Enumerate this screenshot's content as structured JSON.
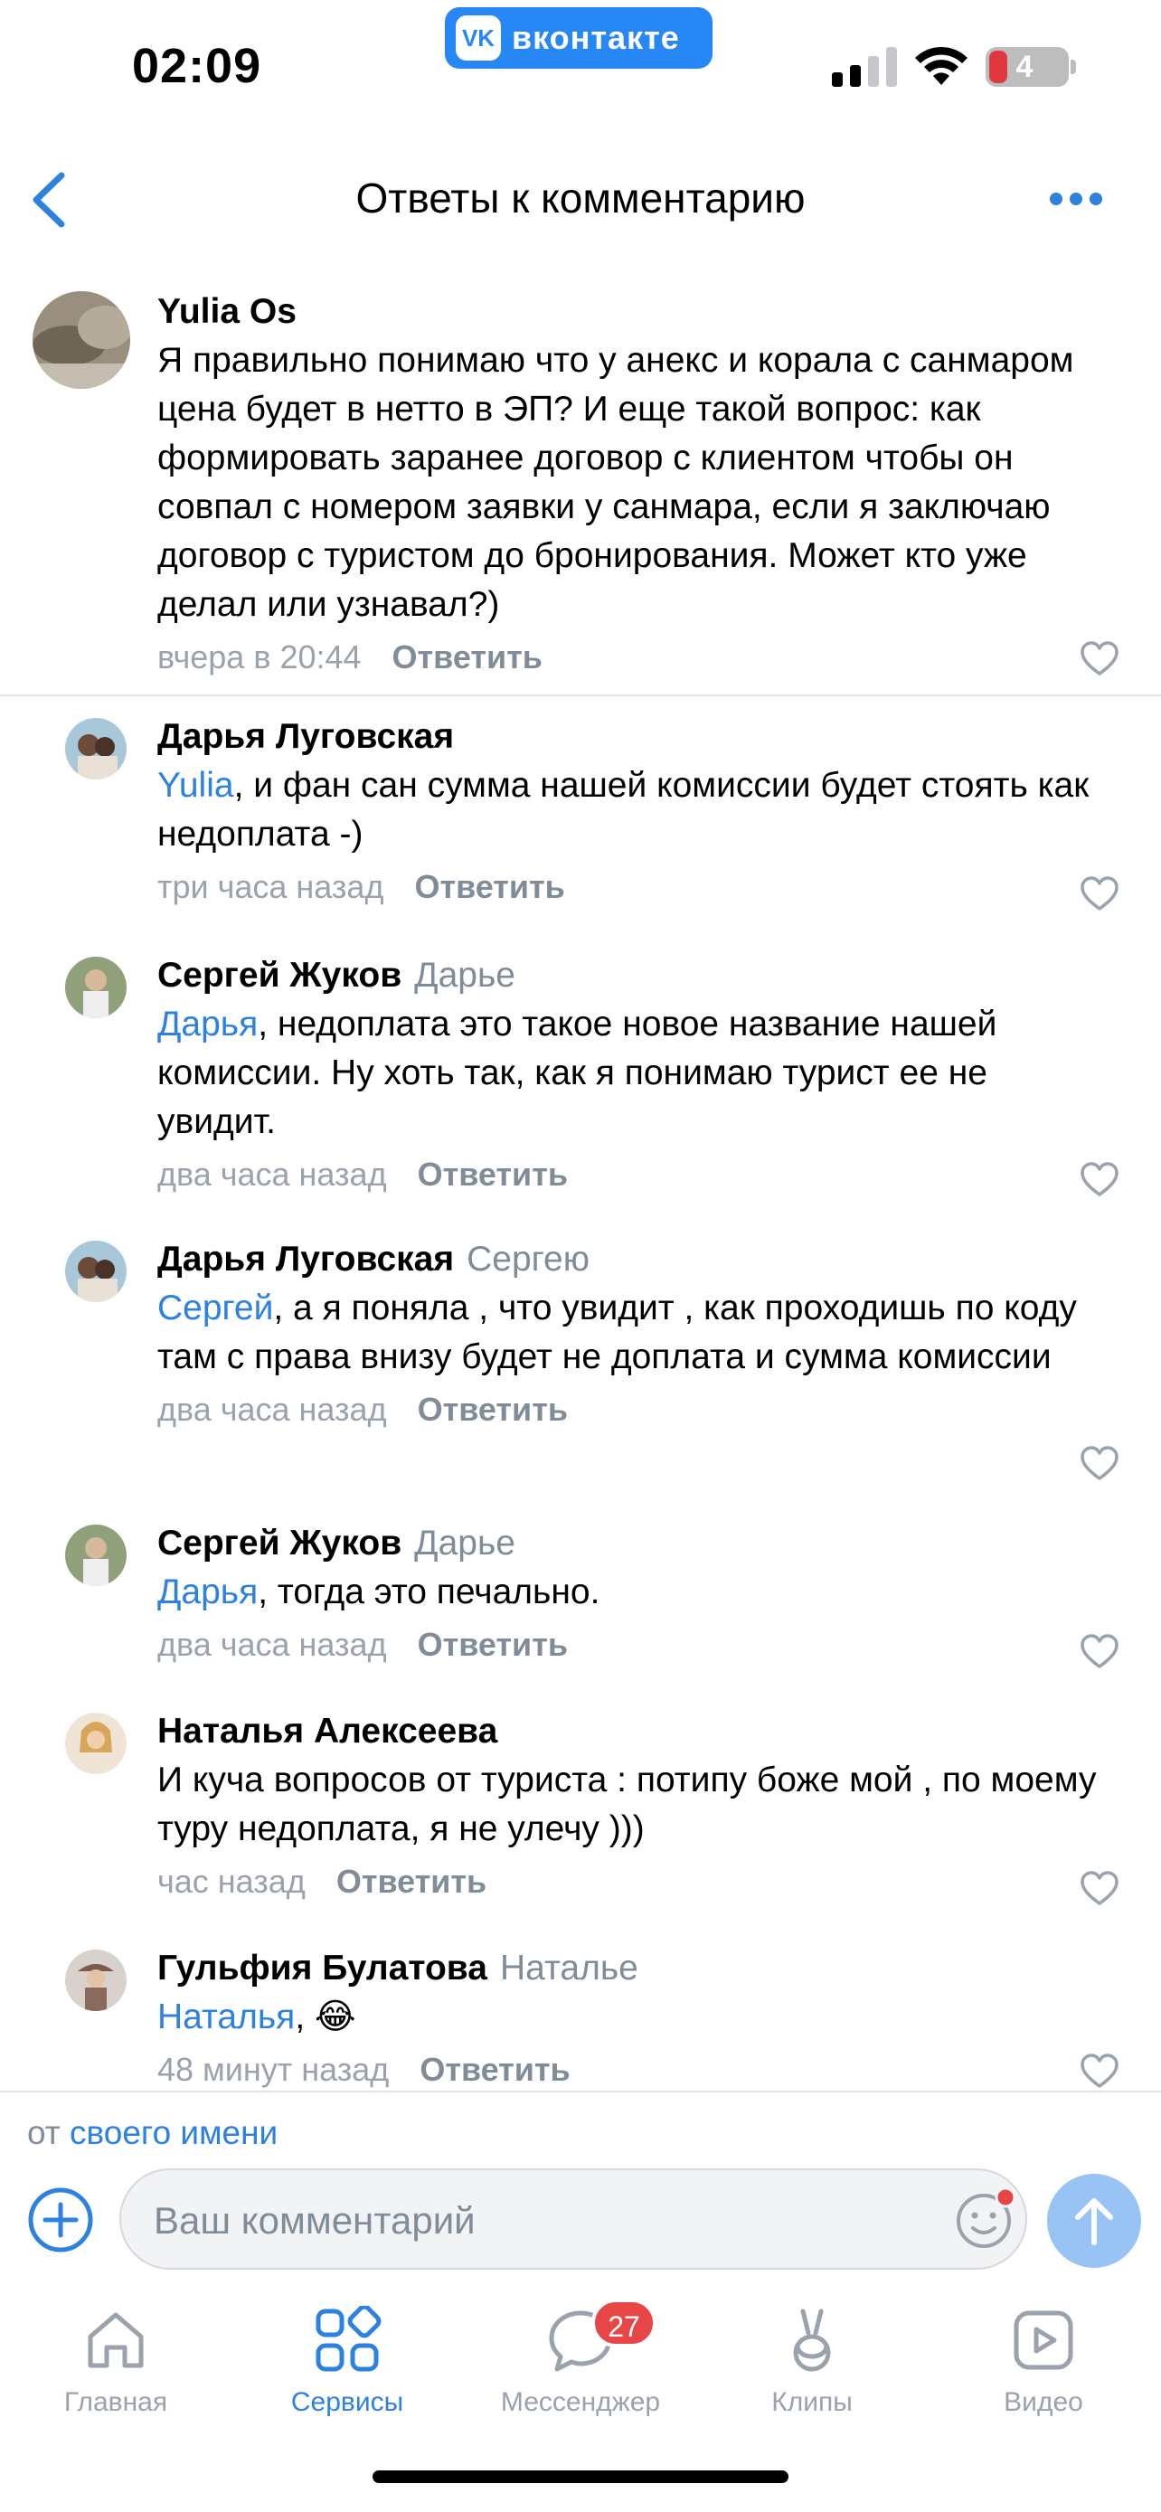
{
  "status_bar": {
    "time": "02:09",
    "app_pill": "вконтакте",
    "battery_level": "4"
  },
  "header": {
    "title": "Ответы к комментарию"
  },
  "main_comment": {
    "author": "Yulia Os",
    "text": "Я правильно понимаю что у анекс и корала с санмаром цена будет в нетто в ЭП? И еще такой вопрос: как формировать заранее договор с клиентом чтобы он совпал с номером заявки у санмара, если я заключаю договор с туристом до бронирования. Может кто уже делал или узнавал?)",
    "time": "вчера в 20:44",
    "reply_label": "Ответить"
  },
  "replies": [
    {
      "author": "Дарья Луговская",
      "to": "",
      "mention": "Yulia",
      "text": ", и фан сан сумма нашей комиссии будет стоять как недоплата -)",
      "time": "три часа назад",
      "reply_label": "Ответить"
    },
    {
      "author": "Сергей Жуков",
      "to": "Дарье",
      "mention": "Дарья",
      "text": ", недоплата это такое новое название нашей комиссии. Ну хоть так, как я понимаю турист ее не увидит.",
      "time": "два часа назад",
      "reply_label": "Ответить"
    },
    {
      "author": "Дарья Луговская",
      "to": "Сергею",
      "mention": "Сергей",
      "text": ", а я поняла , что увидит , как проходишь по коду там с права внизу будет не доплата и сумма комиссии",
      "time": "два часа назад",
      "reply_label": "Ответить"
    },
    {
      "author": "Сергей Жуков",
      "to": "Дарье",
      "mention": "Дарья",
      "text": ", тогда это печально.",
      "time": "два часа назад",
      "reply_label": "Ответить"
    },
    {
      "author": "Наталья Алексеева",
      "to": "",
      "mention": "",
      "text": "И куча вопросов от туриста : потипу боже мой , по моему туру недоплата, я не улечу )))",
      "time": "час назад",
      "reply_label": "Ответить"
    },
    {
      "author": "Гульфия Булатова",
      "to": "Наталье",
      "mention": "Наталья",
      "text": ", 😂",
      "time": "48 минут назад",
      "reply_label": "Ответить"
    }
  ],
  "composer": {
    "from_prefix": "от",
    "from_link": "своего имени",
    "placeholder": "Ваш комментарий"
  },
  "tabbar": {
    "tabs": [
      {
        "label": "Главная"
      },
      {
        "label": "Сервисы"
      },
      {
        "label": "Мессенджер",
        "badge": "27"
      },
      {
        "label": "Клипы"
      },
      {
        "label": "Видео"
      }
    ]
  },
  "colors": {
    "accent": "#2d81e0",
    "secondary_text": "#818c99",
    "badge": "#e64646",
    "vk_blue": "#2787f5"
  }
}
